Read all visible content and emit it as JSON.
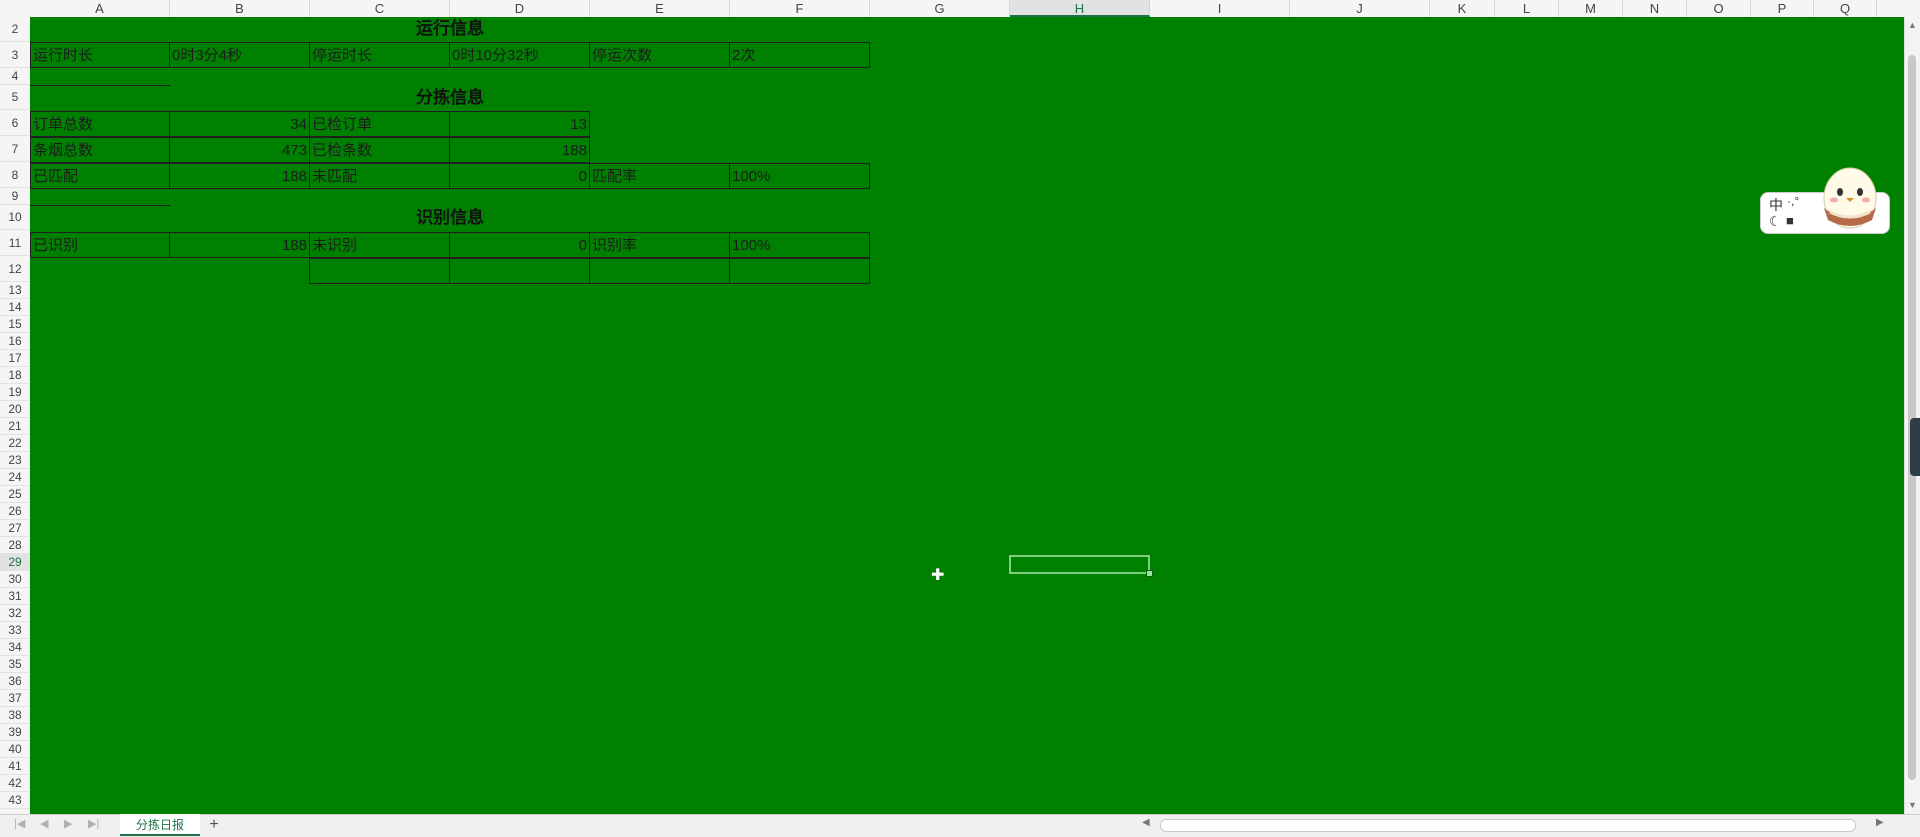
{
  "columns": [
    "A",
    "B",
    "C",
    "D",
    "E",
    "F",
    "G",
    "H",
    "I",
    "J",
    "K",
    "L",
    "M",
    "N",
    "O",
    "P",
    "Q"
  ],
  "active_column": "H",
  "rows": [
    "2",
    "3",
    "4",
    "5",
    "6",
    "7",
    "8",
    "9",
    "10",
    "11",
    "12",
    "13",
    "14",
    "15",
    "16",
    "17",
    "18",
    "19",
    "20",
    "21",
    "22",
    "23",
    "24",
    "25",
    "26",
    "27",
    "28",
    "29",
    "30",
    "31",
    "32",
    "33",
    "34",
    "35",
    "36",
    "37",
    "38",
    "39",
    "40",
    "41",
    "42",
    "43"
  ],
  "active_row": "29",
  "sections": {
    "run_title": "运行信息",
    "sort_title": "分拣信息",
    "recog_title": "识别信息"
  },
  "cells": {
    "r3": {
      "a": "运行时长",
      "b": "0时3分4秒",
      "c": "停运时长",
      "d": "0时10分32秒",
      "e": "停运次数",
      "f": "2次"
    },
    "r6": {
      "a": "订单总数",
      "b": "34",
      "c": "已检订单",
      "d": "13"
    },
    "r7": {
      "a": "条烟总数",
      "b": "473",
      "c": "已检条数",
      "d": "188"
    },
    "r8": {
      "a": "已匹配",
      "b": "188",
      "c": "未匹配",
      "d": "0",
      "e": "匹配率",
      "f": "100%"
    },
    "r11": {
      "a": "已识别",
      "b": "188",
      "c": "未识别",
      "d": "0",
      "e": "识别率",
      "f": "100%"
    }
  },
  "sheet_tab": "分拣日报",
  "add_sheet": "+",
  "ime": {
    "label": "中",
    "punct": "·,°"
  },
  "colors": {
    "grid_bg": "#008000",
    "accent": "#217346"
  }
}
